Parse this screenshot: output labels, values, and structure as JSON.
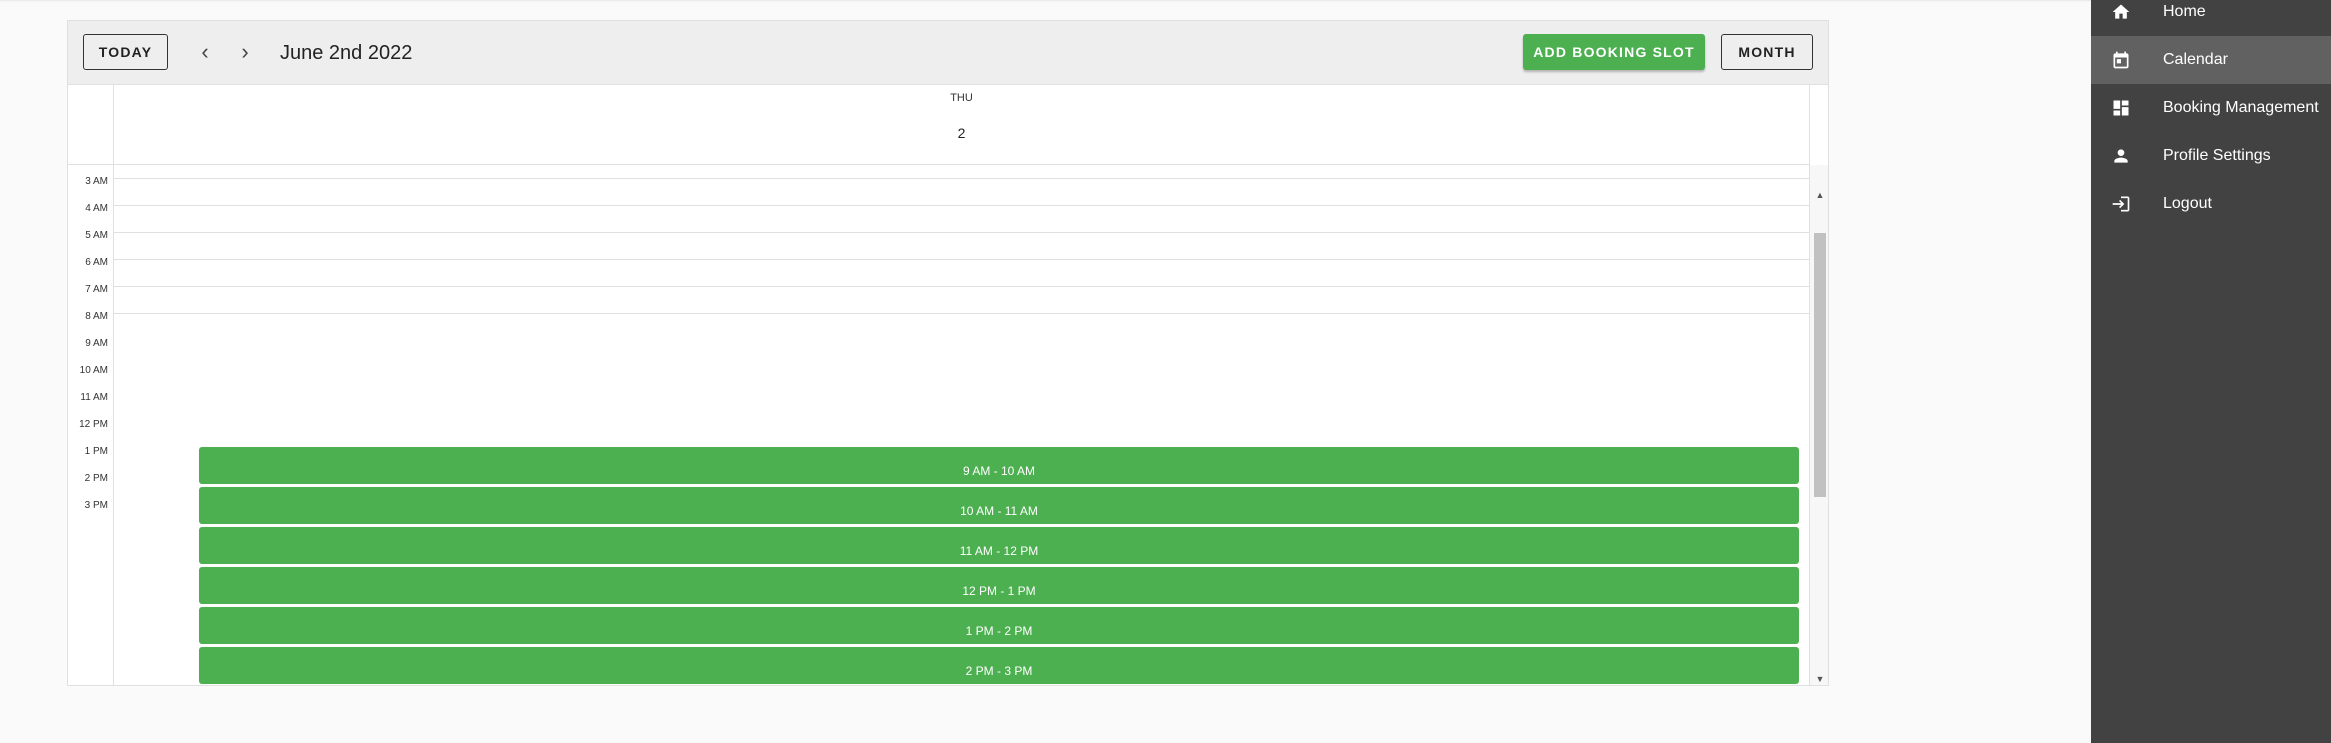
{
  "toolbar": {
    "today_label": "TODAY",
    "prev_icon": "‹",
    "next_icon": "›",
    "date_title": "June 2nd 2022",
    "add_label": "ADD BOOKING SLOT",
    "month_label": "MONTH"
  },
  "day_header": {
    "day_name": "THU",
    "day_number": "2"
  },
  "time_labels": [
    "3 AM",
    "4 AM",
    "5 AM",
    "6 AM",
    "7 AM",
    "8 AM",
    "9 AM",
    "10 AM",
    "11 AM",
    "12 PM",
    "1 PM",
    "2 PM",
    "3 PM"
  ],
  "slots": [
    {
      "label": "9 AM - 10 AM"
    },
    {
      "label": "10 AM - 11 AM"
    },
    {
      "label": "11 AM - 12 PM"
    },
    {
      "label": "12 PM - 1 PM"
    },
    {
      "label": "1 PM - 2 PM"
    },
    {
      "label": "2 PM - 3 PM"
    },
    {
      "label": ""
    }
  ],
  "sidebar": {
    "items": [
      {
        "label": "Home",
        "icon": "home-icon"
      },
      {
        "label": "Calendar",
        "icon": "calendar-icon"
      },
      {
        "label": "Booking Management",
        "icon": "dashboard-icon"
      },
      {
        "label": "Profile Settings",
        "icon": "person-icon"
      },
      {
        "label": "Logout",
        "icon": "logout-icon"
      }
    ],
    "active": "Calendar"
  },
  "colors": {
    "accent": "#4caf50",
    "sidebar_bg": "#424242",
    "sidebar_active": "#616161"
  }
}
